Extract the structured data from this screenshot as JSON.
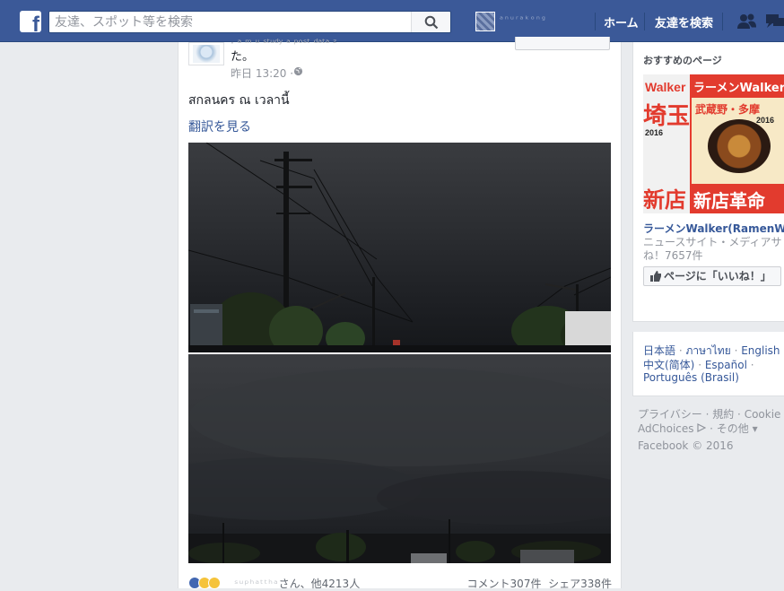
{
  "topbar": {
    "search_placeholder": "友達、スポット等を検索",
    "username_blurred": "ᵃⁿᵘʳᵃᵏᵒⁿᵍ",
    "nav_home": "ホーム",
    "nav_find_friends": "友達を検索",
    "logo_letter": "f"
  },
  "post": {
    "header_fade_text": "· ᵃ ᵐ ᵘ ˢᵗᵘᵈʸ ᵃ ᵖᵒˢᵗ ᵈᵃᵗᵃ ᶻ",
    "header_tail": "た。",
    "time": "昨日 13:20 ·",
    "text": "สกลนคร ณ เวลานี้",
    "translate_link": "翻訳を見る",
    "likers_blurred": "ˢᵘᵖʰᵃᵗᵗʰᵃ",
    "likers_suffix": "さん、他4213人",
    "comments": "コメント307件",
    "shares": "シェア338件"
  },
  "sidebar": {
    "recommended_title": "おすすめのページ",
    "ad": {
      "name": "ラーメンWalker(RamenWalk",
      "desc_line1": "ニュースサイト・メディアサ",
      "desc_line2": "ね！7657件",
      "like_button": "ページに「いいね！」",
      "img_left_top": "Walker",
      "img_left_mid": "埼玉",
      "img_left_year": "2016",
      "img_left_bottom": "新店",
      "img_right_top": "ラーメンWalker",
      "img_right_mid": "武蔵野・多摩",
      "img_right_year": "2016",
      "img_right_bottom": "新店革命"
    },
    "languages": {
      "l1": "日本語",
      "l2": "ภาษาไทย",
      "l3": "English (U",
      "l4": "中文(简体)",
      "l5": "Español",
      "l6": "Português (Brasil)"
    },
    "footer": {
      "privacy": "プライバシー",
      "terms": "規約",
      "cookie": "Cookie",
      "adchoices": "AdChoices",
      "other": "その他",
      "copyright": "Facebook © 2016"
    }
  },
  "colors": {
    "brand": "#3b5998",
    "link": "#365899",
    "like_blue": "#4267b2",
    "wow_yellow": "#f5c33b"
  }
}
